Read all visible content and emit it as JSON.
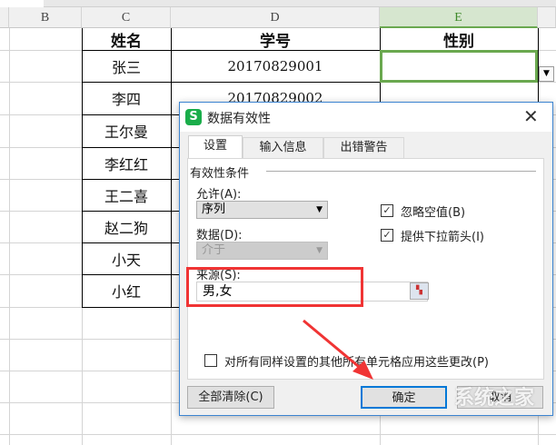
{
  "sheet": {
    "columns": [
      "B",
      "C",
      "D",
      "E"
    ],
    "headers": {
      "name": "姓名",
      "id": "学号",
      "gender": "性别"
    },
    "rows": [
      {
        "name": "张三",
        "id": "20170829001"
      },
      {
        "name": "李四",
        "id": "20170829002"
      },
      {
        "name": "王尔曼"
      },
      {
        "name": "李红红"
      },
      {
        "name": "王二喜"
      },
      {
        "name": "赵二狗"
      },
      {
        "name": "小天"
      },
      {
        "name": "小红"
      }
    ]
  },
  "dialog": {
    "title": "数据有效性",
    "logo": "S",
    "close": "✕",
    "tabs": [
      "设置",
      "输入信息",
      "出错警告"
    ],
    "group_label": "有效性条件",
    "allow_label": "允许(A):",
    "allow_value": "序列",
    "data_label": "数据(D):",
    "data_value": "介于",
    "ignore_blank": {
      "label": "忽略空值(B)",
      "checked": true
    },
    "dropdown_arrow": {
      "label": "提供下拉箭头(I)",
      "checked": true
    },
    "source_label": "来源(S):",
    "source_value": "男,女",
    "apply_all": {
      "label": "对所有同样设置的其他所有单元格应用这些更改(P)",
      "checked": false
    },
    "clear_all": "全部清除(C)",
    "ok": "确定",
    "cancel": "取消"
  },
  "watermark": "系统之家",
  "colors": {
    "accent_green": "#6aa84f",
    "highlight_red": "#f03434",
    "focus_blue": "#0078d7"
  }
}
